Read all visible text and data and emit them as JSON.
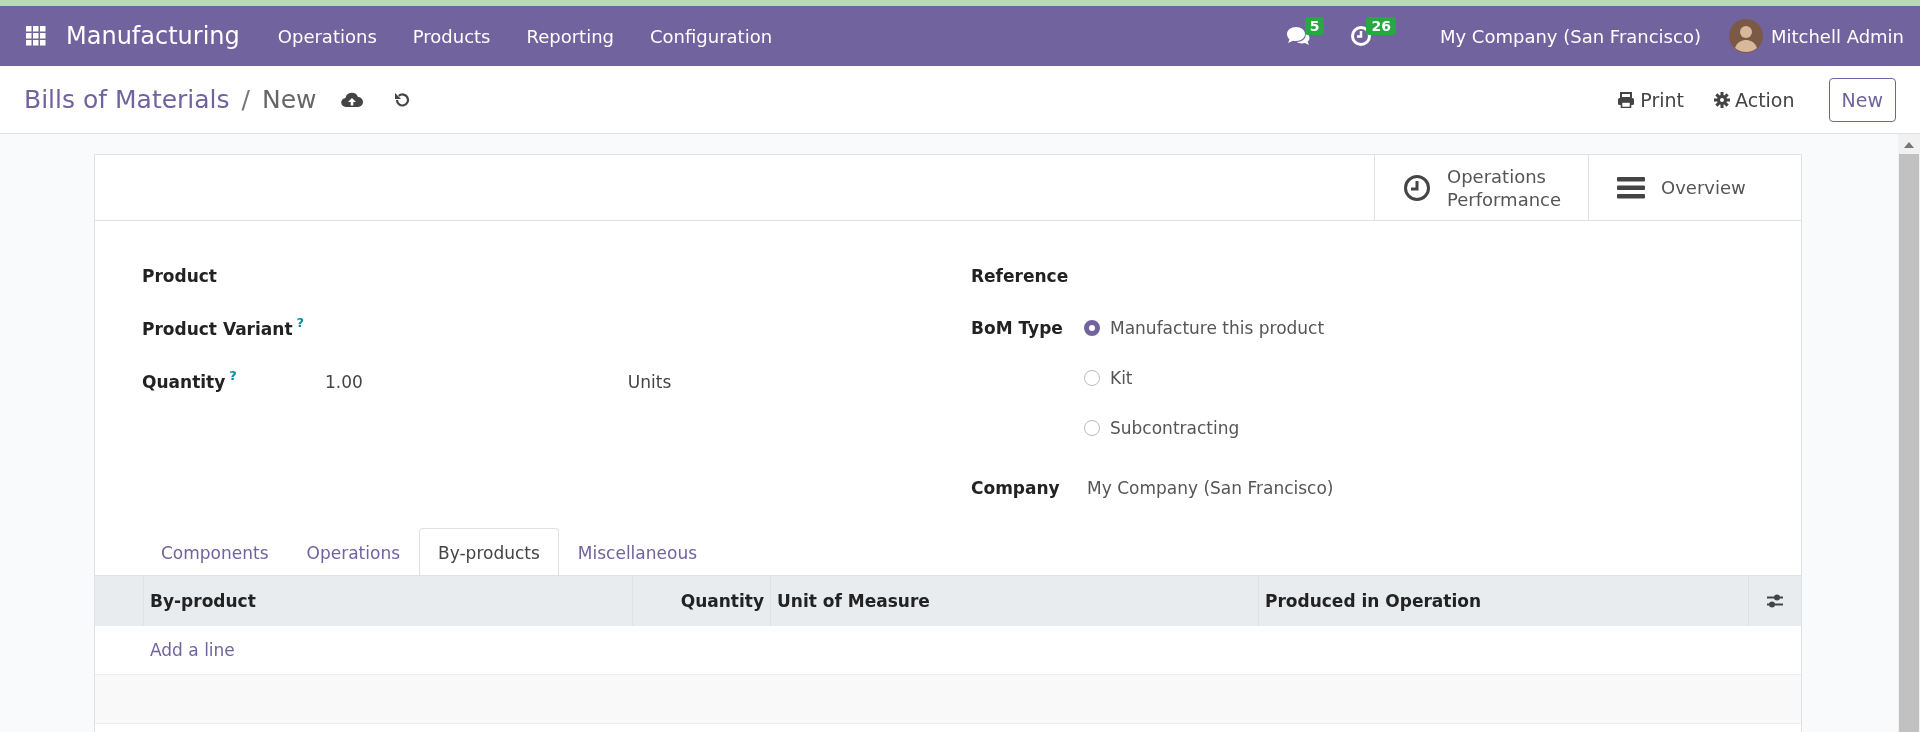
{
  "navbar": {
    "app_name": "Manufacturing",
    "menu": [
      "Operations",
      "Products",
      "Reporting",
      "Configuration"
    ],
    "messages_count": "5",
    "activities_count": "26",
    "company": "My Company (San Francisco)",
    "user": "Mitchell Admin"
  },
  "control_panel": {
    "breadcrumb": "Bills of Materials",
    "separator": "/",
    "current": "New",
    "print": "Print",
    "action": "Action",
    "new_button": "New"
  },
  "smart_buttons": [
    {
      "kind": "clock",
      "label": "Operations Performance"
    },
    {
      "kind": "list",
      "label": "Overview"
    }
  ],
  "left_fields": [
    {
      "label": "Product"
    },
    {
      "label": "Product Variant",
      "help": "?"
    },
    {
      "label": "Quantity",
      "help": "?",
      "value": "1.00",
      "unit": "Units"
    }
  ],
  "reference_label": "Reference",
  "bom_type": {
    "label": "BoM Type",
    "options": [
      {
        "label": "Manufacture this product",
        "selected": true
      },
      {
        "label": "Kit",
        "selected": false
      },
      {
        "label": "Subcontracting",
        "selected": false
      }
    ]
  },
  "company": {
    "label": "Company",
    "value": "My Company (San Francisco)"
  },
  "tabs": [
    {
      "label": "Components",
      "selected": false
    },
    {
      "label": "Operations",
      "selected": false
    },
    {
      "label": "By-products",
      "selected": true
    },
    {
      "label": "Miscellaneous",
      "selected": false
    }
  ],
  "table": {
    "columns": [
      "By-product",
      "Quantity",
      "Unit of Measure",
      "Produced in Operation"
    ],
    "add_line": "Add a line"
  }
}
